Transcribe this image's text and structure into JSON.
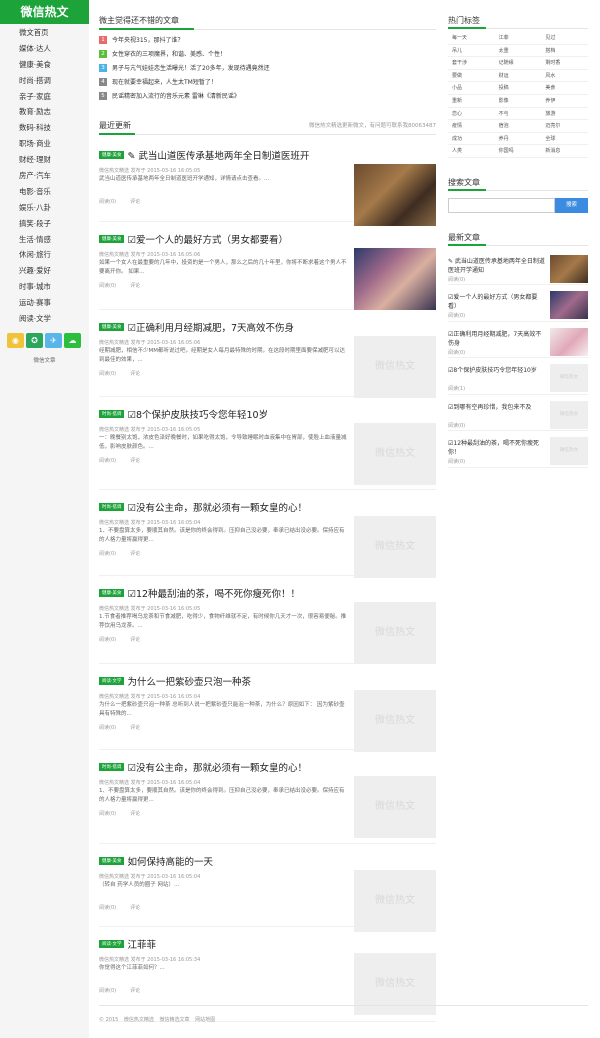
{
  "brand": {
    "logo": "微信热文",
    "color": "#1ca33a"
  },
  "left_nav": [
    "微文首页",
    "媒体·达人",
    "健康·美食",
    "时尚·搭调",
    "亲子·家庭",
    "教育·励志",
    "数码·科技",
    "职场·商业",
    "财经·理财",
    "房产·汽车",
    "电影·音乐",
    "娱乐·八卦",
    "搞笑·段子",
    "生活·情感",
    "休闲·旅行",
    "兴趣·爱好",
    "时事·城市",
    "运动·赛事",
    "阅读·文学"
  ],
  "social": [
    {
      "icon": "rss-icon",
      "color": "#f0c43a",
      "glyph": "◉"
    },
    {
      "icon": "weibo-icon",
      "color": "#2aa75d",
      "glyph": "✪"
    },
    {
      "icon": "qq-icon",
      "color": "#5ab6e8",
      "glyph": "✈"
    },
    {
      "icon": "wechat-icon",
      "color": "#2cbf3e",
      "glyph": "☁"
    }
  ],
  "left_footer": "微信文章",
  "recommend": {
    "title": "微主觉得还不错的文章",
    "items": [
      {
        "num": "1",
        "color": "#e86b6b",
        "text": "今年央视315，那抖了谁？"
      },
      {
        "num": "2",
        "color": "#5cbf3a",
        "text": "女性穿衣的三项魔界，和谐、美感、个性！"
      },
      {
        "num": "3",
        "color": "#4bb3e8",
        "text": "男子与亢气娃娃恋生活曝光！活了20多年，发现待遇竟然还"
      },
      {
        "num": "4",
        "color": "#888888",
        "text": "现在就要幸福起来，人生太TM短暂了！"
      },
      {
        "num": "5",
        "color": "#888888",
        "text": "民谣精密加入流行的音乐元素 雷琳《清新民谣》"
      }
    ]
  },
  "recent": {
    "title": "最近更新",
    "note": "微信热文精选更新微文，有问题可联系我80063487",
    "articles": [
      {
        "tag": "健康·美食",
        "title": "✎ 武当山道医传承基地两年全日制道医班开",
        "meta": "微信热文精选 发布于 2015-03-16 16:05:05",
        "excerpt": "武当山道医传承基地两年全日制道医班开学通知，详情请点击查看。...",
        "read": "阅读(0)",
        "comment": "评论",
        "thumb": ""
      },
      {
        "tag": "健康·美食",
        "title": "☑爱一个人的最好方式（男女都要看）",
        "meta": "微信热文精选 发布于 2015-03-16 16:05:06",
        "excerpt": "如果一个女人在最重要的几年中，投资的是一个男人，那么之后的几十年里，你将不断求着这个男人不要离开你。 如果...",
        "read": "阅读(0)",
        "comment": "评论",
        "thumb": ""
      },
      {
        "tag": "健康·美食",
        "title": "☑正确利用月经期减肥，7天高效不伤身",
        "meta": "微信热文精选 发布于 2015-03-16 16:05:06",
        "excerpt": "经期减肥，相信不少MM都听说过吧，经期是女人每月最特殊的时期，在这段时期里面要保减肥可以达到最佳的效果，...",
        "read": "阅读(0)",
        "comment": "评论",
        "thumb": "微信热文"
      },
      {
        "tag": "时尚·搭调",
        "title": "☑8个保护皮肤技巧令您年轻10岁",
        "meta": "微信热文精选 发布于 2015-03-16 16:05:05",
        "excerpt": "一：晚餐别太饱，浓皮色泽好晚餐时，如果吃得太饱，令导致睡眠时血液集中在胃部，使脸上血液量减低，影响皮肤颜色。...",
        "read": "阅读(0)",
        "comment": "评论",
        "thumb": "微信热文"
      },
      {
        "tag": "时尚·搭调",
        "title": "☑没有公主命，那就必须有一颗女皇的心！",
        "meta": "微信热文精选 发布于 2015-03-16 16:05:04",
        "excerpt": "1、不要盘算太多，要顺其自然。该是你的终会得到。压抑自己没必要，奉承已结出没必要。保持应有的人格力量将赢得更...",
        "read": "阅读(0)",
        "comment": "评论",
        "thumb": "微信热文"
      },
      {
        "tag": "健康·美食",
        "title": "☑12种最刮油的茶，喝不死你瘦死你！！",
        "meta": "微信热文精选 发布于 2015-03-16 16:05:05",
        "excerpt": "1.节食者推荐喝乌龙茶和节食减肥，吃得少，食物纤维就不足，有时候你几天才一次，很容易便秘。推荐饮用乌龙茶。...",
        "read": "阅读(0)",
        "comment": "评论",
        "thumb": "微信热文"
      },
      {
        "tag": "阅读·文学",
        "title": "为什么一把紫砂壶只泡一种茶",
        "meta": "微信热文精选 发布于 2015-03-16 16:05:04",
        "excerpt": "为什么一把紫砂壶只泡一种茶 总听到人说一把紫砂壶只能泡一种茶，为什么？原因如下： 因为紫砂壶具有特殊的...",
        "read": "阅读(0)",
        "comment": "评论",
        "thumb": "微信热文"
      },
      {
        "tag": "时尚·搭调",
        "title": "☑没有公主命，那就必须有一颗女皇的心！",
        "meta": "微信热文精选 发布于 2015-03-16 16:05:04",
        "excerpt": "1、不要盘算太多，要顺其自然。该是你的终会得到。压抑自己没必要，奉承已结出没必要。保持应有的人格力量将赢得更...",
        "read": "阅读(0)",
        "comment": "评论",
        "thumb": "微信热文"
      },
      {
        "tag": "健康·美食",
        "title": "如何保持高能的一天",
        "meta": "微信热文精选 发布于 2015-03-16 16:05:04",
        "excerpt": "（转自 药学人员的圈子 网站）...",
        "read": "阅读(0)",
        "comment": "评论",
        "thumb": "微信热文"
      },
      {
        "tag": "阅读·文学",
        "title": "江菲菲",
        "meta": "微信热文精选 发布于 2015-03-16 16:05:34",
        "excerpt": "你觉得这个江菲菲如何？...",
        "read": "阅读(0)",
        "comment": "评论",
        "thumb": "微信热文"
      }
    ]
  },
  "hot_tags": {
    "title": "热门标签",
    "items": [
      "每一天",
      "江菲",
      "见过",
      "吊儿",
      "太重",
      "搭档",
      "套干涉",
      "记随缘",
      "剩时香",
      "要做",
      "财运",
      "风水",
      "小品",
      "投稿",
      "美食",
      "重新",
      "影像",
      "养伊",
      "恋心",
      "不与",
      "旅游",
      "疫情",
      "宿泡",
      "迈亮尔",
      "成功",
      "养丹",
      "全球",
      "人类",
      "你国吗",
      "新消息"
    ]
  },
  "search": {
    "title": "搜索文章",
    "button": "搜索",
    "placeholder": ""
  },
  "latest": {
    "title": "最新文章",
    "items": [
      {
        "title": "✎ 武当山道医传承基地两年全日制道医班开学通知",
        "read": "阅读(0)",
        "thumb": ""
      },
      {
        "title": "☑爱一个人的最好方式（男女都要看）",
        "read": "阅读(0)",
        "thumb": ""
      },
      {
        "title": "☑正确利用月经期减肥，7天高效不伤身",
        "read": "阅读(0)",
        "thumb": ""
      },
      {
        "title": "☑8个保护皮肤技巧令您年轻10岁",
        "read": "阅读(1)",
        "thumb": "微信热文"
      },
      {
        "title": "☑到哪有空再珍惜，我包来不及",
        "read": "阅读(0)",
        "thumb": "微信热文"
      },
      {
        "title": "☑12种最刮油的茶，喝不死你瘦死你！",
        "read": "阅读(0)",
        "thumb": "微信热文"
      }
    ]
  },
  "footer": {
    "copyright": "© 2015",
    "site": "微信热文精选",
    "links": [
      "微信精选文章",
      "网站地图"
    ]
  }
}
